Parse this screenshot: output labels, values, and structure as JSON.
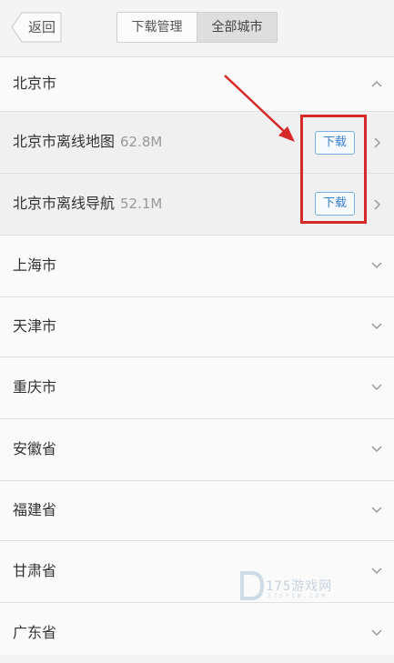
{
  "header": {
    "back_label": "返回",
    "tabs": [
      {
        "label": "下载管理",
        "active": false
      },
      {
        "label": "全部城市",
        "active": true
      }
    ]
  },
  "expanded_city": {
    "name": "北京市",
    "state": "expanded",
    "items": [
      {
        "name": "北京市离线地图",
        "size": "62.8M",
        "button": "下载"
      },
      {
        "name": "北京市离线导航",
        "size": "52.1M",
        "button": "下载"
      }
    ]
  },
  "cities": [
    {
      "name": "上海市"
    },
    {
      "name": "天津市"
    },
    {
      "name": "重庆市"
    },
    {
      "name": "安徽省"
    },
    {
      "name": "福建省"
    },
    {
      "name": "甘肃省"
    },
    {
      "name": "广东省"
    }
  ],
  "annotation": {
    "color": "#d62a2a"
  },
  "watermark": {
    "text": "175游戏网",
    "subtext": "17SYSW.COM"
  }
}
